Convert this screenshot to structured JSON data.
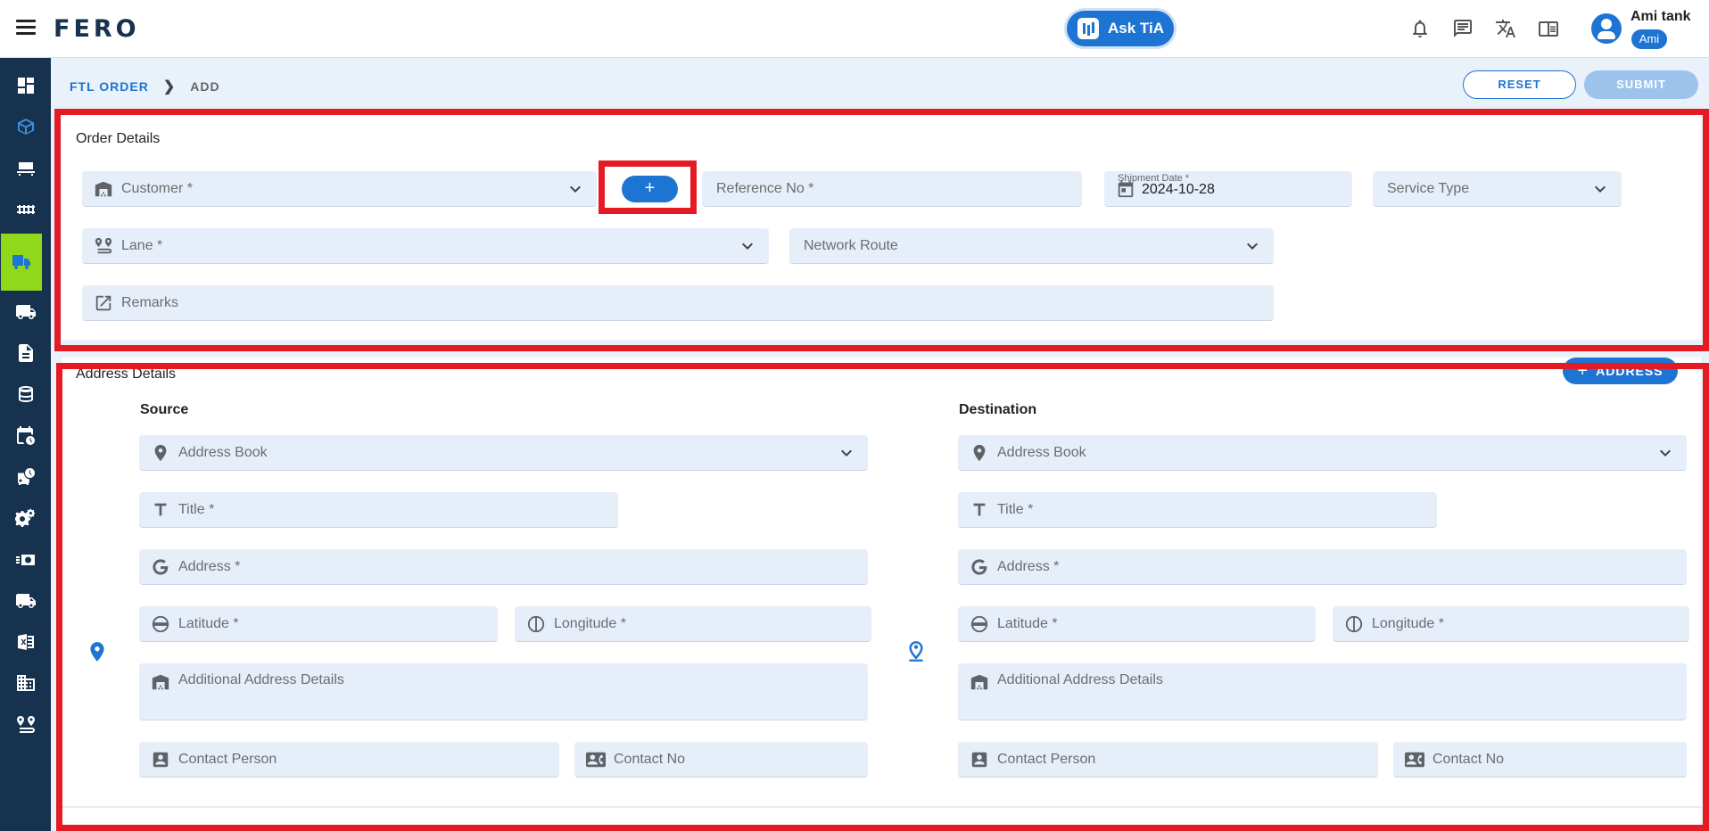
{
  "header": {
    "logo": "FERO",
    "ask_tia": "Ask TiA",
    "user_name": "Ami tank",
    "user_badge": "Ami"
  },
  "breadcrumb": {
    "root": "FTL ORDER",
    "current": "ADD"
  },
  "actions": {
    "reset": "RESET",
    "submit": "SUBMIT"
  },
  "order_details": {
    "title": "Order Details",
    "customer": "Customer *",
    "add_customer": "+",
    "reference_no": "Reference No *",
    "shipment_date_label": "Shipment Date *",
    "shipment_date": "2024-10-28",
    "service_type": "Service Type",
    "lane": "Lane *",
    "network_route": "Network Route",
    "remarks": "Remarks"
  },
  "address_details": {
    "title": "Address Details",
    "add_address": "ADDRESS",
    "source": {
      "heading": "Source",
      "address_book": "Address Book",
      "title": "Title *",
      "address": "Address *",
      "latitude": "Latitude *",
      "longitude": "Longitude *",
      "additional": "Additional Address Details",
      "contact_person": "Contact Person",
      "contact_no": "Contact No"
    },
    "destination": {
      "heading": "Destination",
      "address_book": "Address Book",
      "title": "Title *",
      "address": "Address *",
      "latitude": "Latitude *",
      "longitude": "Longitude *",
      "additional": "Additional Address Details",
      "contact_person": "Contact Person",
      "contact_no": "Contact No"
    }
  },
  "colors": {
    "primary": "#1e74d2",
    "sidebar": "#16324f",
    "highlight_red": "#e41b23",
    "highlight_green": "#8fd81a",
    "field_bg": "#e6eefa"
  }
}
